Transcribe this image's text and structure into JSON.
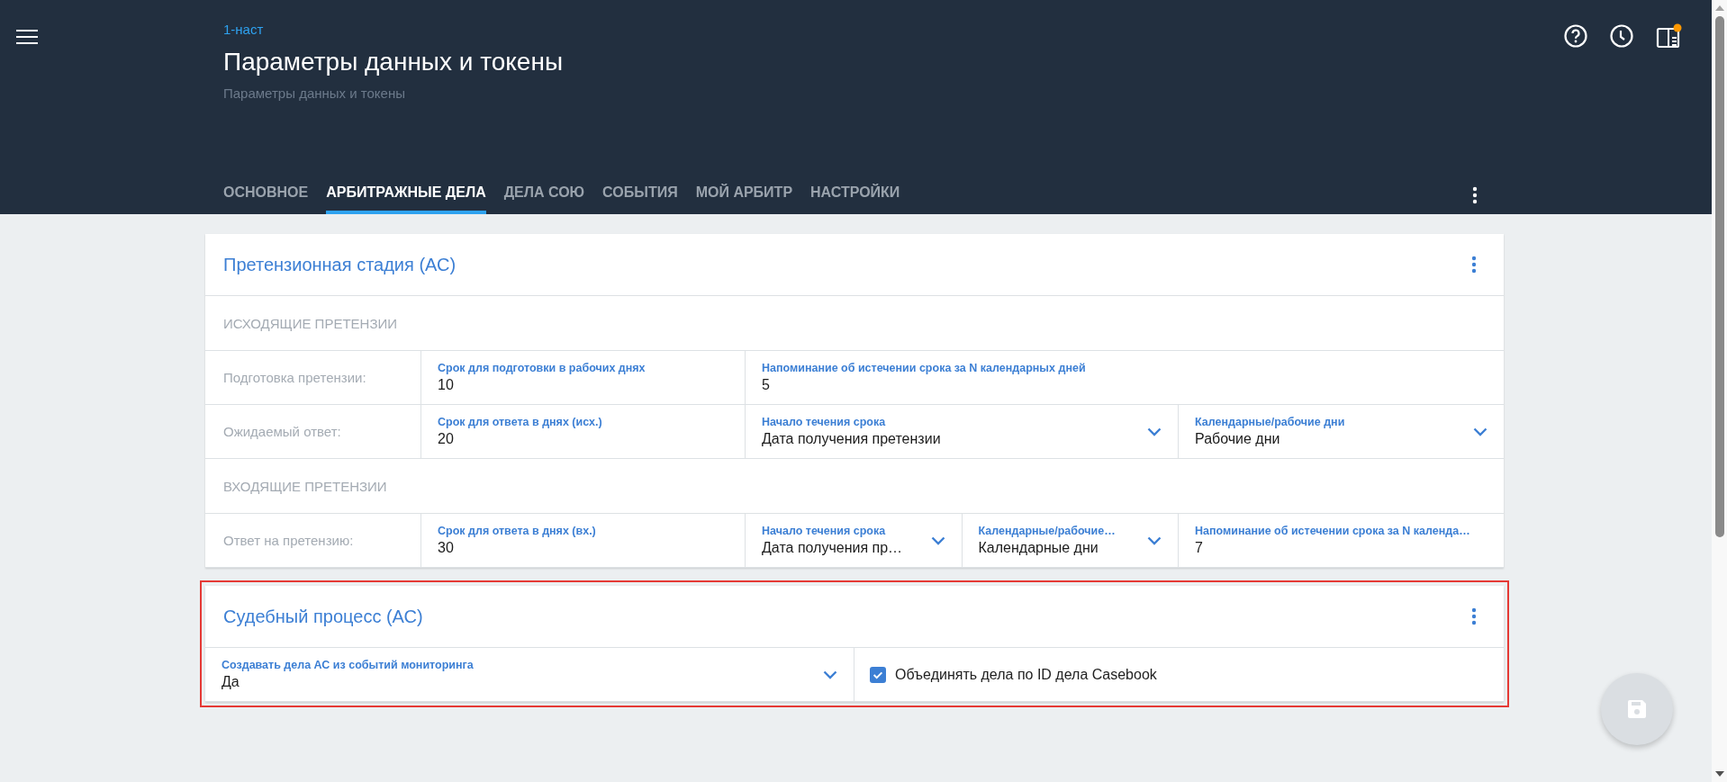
{
  "header": {
    "breadcrumb": "1-наст",
    "title": "Параметры данных и токены",
    "subtitle": "Параметры данных и токены"
  },
  "tabs": [
    {
      "label": "ОСНОВНОЕ",
      "selected": false
    },
    {
      "label": "АРБИТРАЖНЫЕ ДЕЛА",
      "selected": true
    },
    {
      "label": "ДЕЛА СОЮ",
      "selected": false
    },
    {
      "label": "СОБЫТИЯ",
      "selected": false
    },
    {
      "label": "МОЙ АРБИТР",
      "selected": false
    },
    {
      "label": "НАСТРОЙКИ",
      "selected": false
    }
  ],
  "cards": [
    {
      "title": "Претензионная стадия (АС)",
      "highlighted": false,
      "rows": [
        {
          "kind": "section",
          "label": "ИСХОДЯЩИЕ ПРЕТЕНЗИИ"
        },
        {
          "kind": "fields",
          "label": "Подготовка претензии:",
          "fields": [
            {
              "kind": "input",
              "label": "Срок для подготовки в рабочих днях",
              "value": "10"
            },
            {
              "kind": "input",
              "label": "Напоминание об истечении срока за N календарных дней",
              "value": "5"
            }
          ]
        },
        {
          "kind": "fields",
          "label": "Ожидаемый ответ:",
          "fields": [
            {
              "kind": "input",
              "label": "Срок для ответа в днях (исх.)",
              "value": "20"
            },
            {
              "kind": "select",
              "label": "Начало течения срока",
              "value": "Дата получения претензии"
            },
            {
              "kind": "select",
              "label": "Календарные/рабочие дни",
              "value": "Рабочие дни"
            }
          ]
        },
        {
          "kind": "section",
          "label": "ВХОДЯЩИЕ ПРЕТЕНЗИИ"
        },
        {
          "kind": "fields",
          "label": "Ответ на претензию:",
          "fields": [
            {
              "kind": "input",
              "label": "Срок для ответа в днях (вх.)",
              "value": "30"
            },
            {
              "kind": "select",
              "label": "Начало течения срока",
              "value": "Дата получения пр…"
            },
            {
              "kind": "select",
              "label": "Календарные/рабочие…",
              "value": "Календарные дни"
            },
            {
              "kind": "input",
              "label": "Напоминание об истечении срока за N календа…",
              "value": "7"
            }
          ]
        }
      ]
    },
    {
      "title": "Судебный процесс (АС)",
      "highlighted": true,
      "rows": [
        {
          "kind": "fields",
          "fields": [
            {
              "kind": "select",
              "label": "Создавать дела АС из событий мониторинга",
              "value": "Да"
            },
            {
              "kind": "checkbox",
              "label": "Объединять дела по ID дела Casebook",
              "checked": true
            }
          ]
        }
      ]
    }
  ],
  "save_button": {
    "disabled": true
  }
}
